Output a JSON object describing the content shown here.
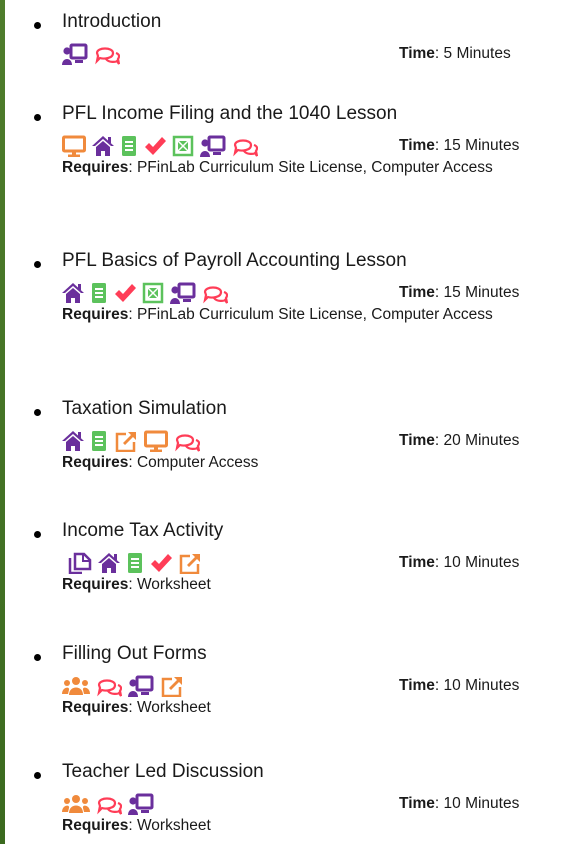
{
  "labels": {
    "time": "Time",
    "requires": "Requires"
  },
  "colors": {
    "purple": "#6a2f9c",
    "orange": "#f08a3c",
    "green": "#5cc25c",
    "red": "#ff3d57",
    "crimson": "#e64545"
  },
  "items": [
    {
      "title": "Introduction",
      "icons": [
        "presentation-icon",
        "chat-bubbles-icon"
      ],
      "time": ": 5 Minutes",
      "requires": ""
    },
    {
      "title": "PFL Income Filing and the 1040 Lesson",
      "icons": [
        "monitor-icon",
        "home-icon",
        "notebook-icon",
        "checkmark-icon",
        "calculator-icon",
        "presentation-icon",
        "chat-bubbles-icon"
      ],
      "time": ": 15 Minutes",
      "requires": ": PFinLab Curriculum Site License, Computer Access"
    },
    {
      "title": "PFL Basics of Payroll Accounting  Lesson",
      "icons": [
        "home-icon",
        "notebook-icon",
        "checkmark-icon",
        "calculator-icon",
        "presentation-icon",
        "chat-bubbles-icon"
      ],
      "time": ": 15 Minutes",
      "requires": ": PFinLab Curriculum Site License, Computer Access"
    },
    {
      "title": "Taxation Simulation",
      "icons": [
        "home-icon",
        "notebook-icon",
        "external-link-icon",
        "monitor-icon",
        "chat-bubbles-icon"
      ],
      "time": ": 20 Minutes",
      "requires": ": Computer Access"
    },
    {
      "title": "Income Tax Activity",
      "icons": [
        "copy-pages-icon",
        "home-icon",
        "notebook-icon",
        "checkmark-icon",
        "external-link-icon"
      ],
      "time": ": 10 Minutes",
      "requires": ":  Worksheet"
    },
    {
      "title": "Filling  Out Forms",
      "icons": [
        "group-icon",
        "chat-bubbles-icon",
        "presentation-icon",
        "external-link-icon"
      ],
      "time": ": 10 Minutes",
      "requires": ": Worksheet"
    },
    {
      "title": "Teacher Led Discussion",
      "icons": [
        "group-icon",
        "chat-bubbles-icon",
        "presentation-icon"
      ],
      "time": ": 10 Minutes",
      "requires": ": Worksheet"
    }
  ]
}
